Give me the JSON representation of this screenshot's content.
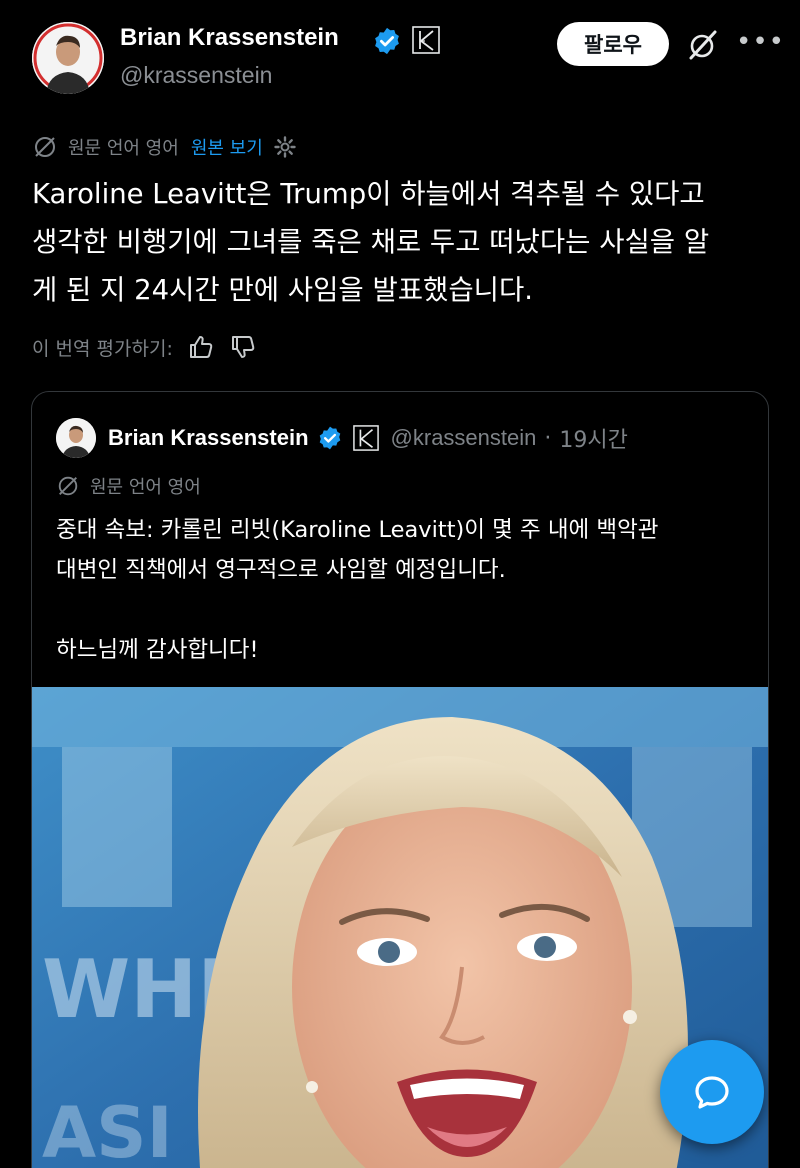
{
  "author": {
    "name": "Brian Krassenstein",
    "handle": "@krassenstein"
  },
  "actions": {
    "follow_label": "팔로우",
    "more_icon": "more-icon",
    "grok_icon": "grok-icon"
  },
  "translation": {
    "source_language": "원문 언어 영어",
    "show_original": "원본 보기",
    "rate_label": "이 번역 평가하기:"
  },
  "post": {
    "lines": [
      "Karoline Leavitt은 Trump이 하늘에서 격추될 수 있다고",
      "생각한 비행기에 그녀를 죽은 채로 두고 떠났다는 사실을 알",
      "게 된 지 24시간 만에 사임을 발표했습니다."
    ]
  },
  "quote": {
    "name": "Brian Krassenstein",
    "handle": "@krassenstein",
    "separator": "·",
    "time": "19시간",
    "source_language": "원문 언어 영어",
    "lines": [
      "중대 속보: 카롤린 리빗(Karoline Leavitt)이 몇 주 내에 백악관",
      "대변인 직책에서 영구적으로 사임할 예정입니다."
    ],
    "closing": "하느님께 감사합니다!"
  },
  "colors": {
    "background": "#000000",
    "accent": "#1d9bf0",
    "muted": "#7e8388"
  }
}
